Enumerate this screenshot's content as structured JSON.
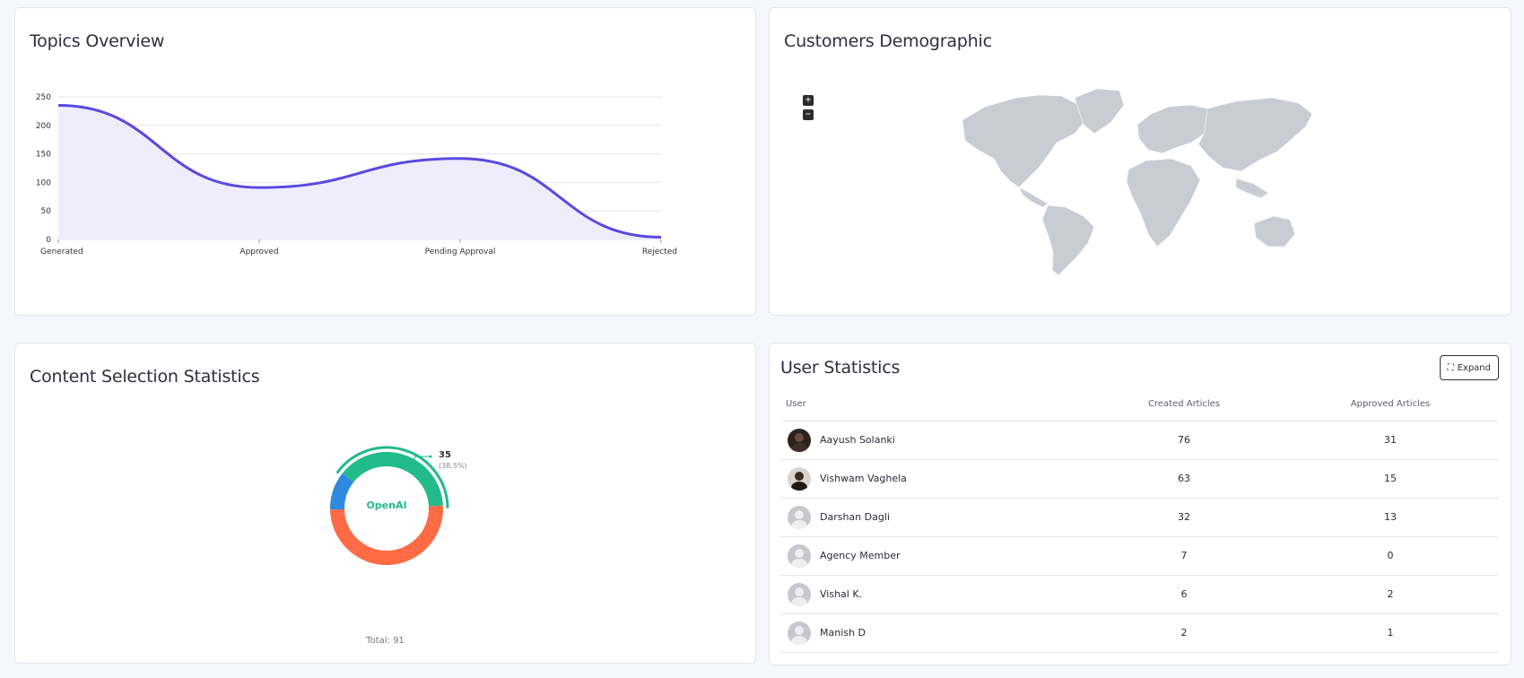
{
  "topics": {
    "title": "Topics Overview",
    "chart_data": {
      "type": "area",
      "categories": [
        "Generated",
        "Approved",
        "Pending Approval",
        "Rejected"
      ],
      "values": [
        235,
        91,
        142,
        4
      ],
      "yticks": [
        0,
        50,
        100,
        150,
        200,
        250
      ],
      "ylim": [
        0,
        250
      ],
      "color": "#5b48e0",
      "fill": "#efecfb",
      "grid": true
    }
  },
  "demographic": {
    "title": "Customers Demographic",
    "zoom_in": "+",
    "zoom_out": "−",
    "map_color": "#c9ccd3"
  },
  "content": {
    "title": "Content Selection Statistics",
    "chart_data": {
      "type": "pie",
      "center_label": "OpenAI",
      "callout_value": "35",
      "callout_percent": "(38.5%)",
      "segments": [
        {
          "value": 35,
          "color": "#22bb8a"
        },
        {
          "value": 46,
          "color": "#ff6b45"
        },
        {
          "value": 10,
          "color": "#2d8ae0"
        }
      ]
    },
    "total_label": "Total: 91"
  },
  "users": {
    "title": "User Statistics",
    "expand_label": "Expand",
    "columns": [
      "User",
      "Created Articles",
      "Approved Articles"
    ],
    "rows": [
      {
        "name": "Aayush Solanki",
        "created": "76",
        "approved": "31"
      },
      {
        "name": "Vishwam Vaghela",
        "created": "63",
        "approved": "15"
      },
      {
        "name": "Darshan Dagli",
        "created": "32",
        "approved": "13"
      },
      {
        "name": "Agency Member",
        "created": "7",
        "approved": "0"
      },
      {
        "name": "Vishal K.",
        "created": "6",
        "approved": "2"
      },
      {
        "name": "Manish D",
        "created": "2",
        "approved": "1"
      }
    ]
  }
}
